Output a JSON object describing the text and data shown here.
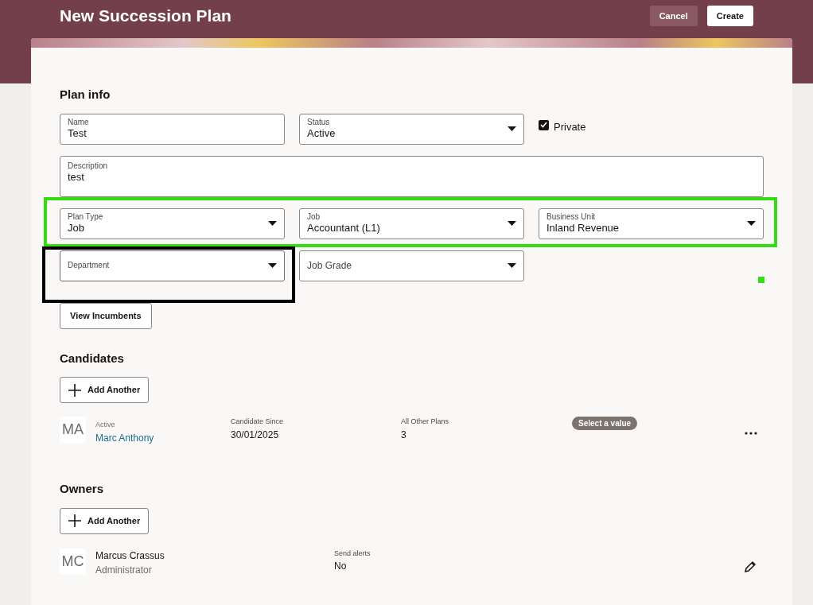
{
  "header": {
    "title": "New Succession Plan",
    "buttons": [
      {
        "label": "Cancel",
        "kind": "secondary"
      },
      {
        "label": "Create",
        "kind": "primary"
      }
    ]
  },
  "plan_info": {
    "heading": "Plan info",
    "rows": [
      [
        {
          "kind": "text",
          "label": "Name",
          "value": "Test"
        },
        {
          "kind": "select",
          "label": "Status",
          "value": "Active"
        },
        {
          "kind": "checkbox",
          "label": "Private",
          "checked": true
        }
      ],
      [
        {
          "kind": "textarea",
          "label": "Description",
          "value": "test"
        }
      ],
      [
        {
          "kind": "select",
          "label": "Plan Type",
          "value": "Job"
        },
        {
          "kind": "select",
          "label": "Job",
          "value": "Accountant (L1)"
        },
        {
          "kind": "select",
          "label": "Business Unit",
          "value": "Inland Revenue"
        }
      ],
      [
        {
          "kind": "select",
          "label": "Department",
          "focused": true
        },
        {
          "kind": "select",
          "label": "Job Grade",
          "focused": false
        }
      ]
    ],
    "action": "View Incumbents"
  },
  "candidates": {
    "heading": "Candidates",
    "add_button": "Add Another",
    "items": [
      {
        "initials": "MA",
        "status": "Active",
        "name": "Marc Anthony",
        "since_label": "Candidate Since",
        "since": "30/01/2025",
        "plans_label": "All Other Plans",
        "plans": "3",
        "badge": "Select a value"
      }
    ]
  },
  "owners": {
    "heading": "Owners",
    "add_button": "Add Another",
    "items": [
      {
        "initials": "MC",
        "name": "Marcus Crassus",
        "role": "Administrator",
        "alerts_label": "Send alerts",
        "alerts": "No"
      }
    ]
  },
  "highlights": [
    {
      "kind": "frame",
      "color": "#33dd11"
    },
    {
      "kind": "frame",
      "color": "#000000"
    },
    {
      "kind": "dot",
      "color": "#33dd11"
    }
  ]
}
